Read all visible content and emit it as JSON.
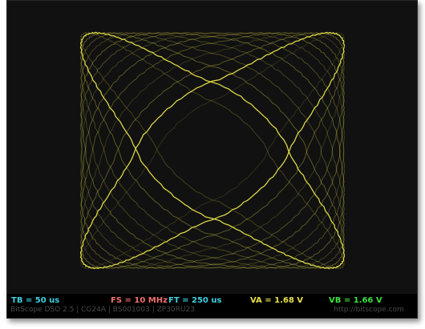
{
  "readouts": {
    "tb": "TB = 50 us",
    "fs": "FS = 10 MHz",
    "ft": "FT = 250 us",
    "va": "VA = 1.68 V",
    "vb": "VB = 1.66 V"
  },
  "footer": {
    "info": "BitScope DSO 2.5 | CG24A | BS001003 | ZP30RU23",
    "url": "http://bitscope.com"
  },
  "colors": {
    "trace": "#e6e04a",
    "tb": "#3ed0e0",
    "fs": "#f07070",
    "ft": "#3ed0e0",
    "va": "#e8e04a",
    "vb": "#3ee03e"
  }
}
